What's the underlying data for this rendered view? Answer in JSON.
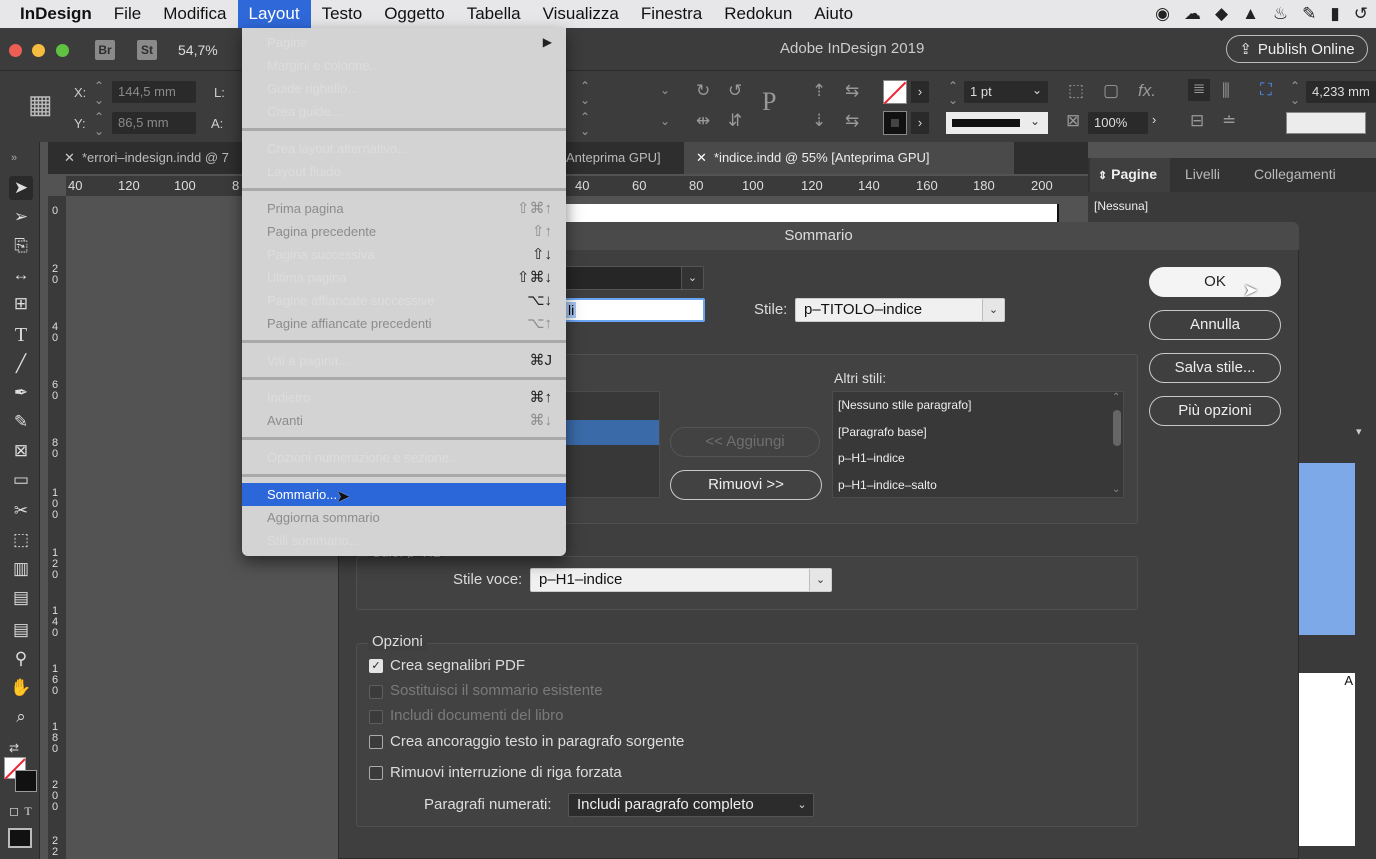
{
  "menubar": {
    "app": "InDesign",
    "items": [
      "File",
      "Modifica",
      "Layout",
      "Testo",
      "Oggetto",
      "Tabella",
      "Visualizza",
      "Finestra",
      "Redokun",
      "Aiuto"
    ]
  },
  "titlebar": {
    "br": "Br",
    "st": "St",
    "zoom": "54,7%",
    "title": "Adobe InDesign 2019",
    "publish": "Publish Online"
  },
  "controlbar": {
    "x_label": "X:",
    "x_value": "144,5 mm",
    "y_label": "Y:",
    "y_value": "86,5 mm",
    "l_label": "L:",
    "a_label": "A:",
    "stroke_weight": "1 pt",
    "opacity": "100%",
    "spacing": "4,233 mm"
  },
  "tabs": {
    "tab1": "*errori–indesign.indd @ 7",
    "tab2": "Anteprima GPU]",
    "tab3": "*indice.indd @ 55% [Anteprima GPU]"
  },
  "ruler": {
    "left": [
      "40",
      "120",
      "100",
      "8"
    ],
    "right": [
      "40",
      "60",
      "80",
      "100",
      "120",
      "140",
      "160",
      "180",
      "200"
    ],
    "vertical": [
      "0",
      "2\n0",
      "4\n0",
      "6\n0",
      "8\n0",
      "1\n0\n0",
      "1\n2\n0",
      "1\n4\n0",
      "1\n6\n0",
      "1\n8\n0",
      "2\n0\n0",
      "2\n2"
    ]
  },
  "panel": {
    "tabs": [
      "Pagine",
      "Livelli",
      "Collegamenti"
    ],
    "none": "[Nessuna]",
    "a_letter": "A"
  },
  "menu": {
    "items": [
      {
        "label": "Pagine",
        "shortcut": "▶",
        "disabled": false
      },
      {
        "label": "Margini e colonne...",
        "shortcut": "",
        "disabled": false
      },
      {
        "label": "Guide righello...",
        "shortcut": "",
        "disabled": false
      },
      {
        "label": "Crea guide...",
        "shortcut": "",
        "disabled": false
      },
      {
        "label": "Crea layout alternativo...",
        "shortcut": "",
        "disabled": false
      },
      {
        "label": "Layout fluido",
        "shortcut": "",
        "disabled": false
      },
      {
        "label": "Prima pagina",
        "shortcut": "⇧⌘↑",
        "disabled": true
      },
      {
        "label": "Pagina precedente",
        "shortcut": "⇧↑",
        "disabled": true
      },
      {
        "label": "Pagina successiva",
        "shortcut": "⇧↓",
        "disabled": false
      },
      {
        "label": "Ultima pagina",
        "shortcut": "⇧⌘↓",
        "disabled": false
      },
      {
        "label": "Pagine affiancate successive",
        "shortcut": "⌥↓",
        "disabled": false
      },
      {
        "label": "Pagine affiancate precedenti",
        "shortcut": "⌥↑",
        "disabled": true
      },
      {
        "label": "Vai a pagina...",
        "shortcut": "⌘J",
        "disabled": false
      },
      {
        "label": "Indietro",
        "shortcut": "⌘↑",
        "disabled": false
      },
      {
        "label": "Avanti",
        "shortcut": "⌘↓",
        "disabled": true
      },
      {
        "label": "Opzioni numerazione e sezione...",
        "shortcut": "",
        "disabled": false
      },
      {
        "label": "Sommario...",
        "shortcut": "",
        "disabled": false,
        "highlighted": true
      },
      {
        "label": "Aggiorna sommario",
        "shortcut": "",
        "disabled": true
      },
      {
        "label": "Stili sommario...",
        "shortcut": "",
        "disabled": false
      }
    ]
  },
  "dialog": {
    "title": "Sommario",
    "title_field_value": "li",
    "style_label": "Stile:",
    "style_value": "p–TITOLO–indice",
    "buttons": {
      "ok": "OK",
      "cancel": "Annulla",
      "save": "Salva stile...",
      "more": "Più opzioni"
    },
    "add_button": "<< Aggiungi",
    "remove_button": "Rimuovi >>",
    "other_styles_label": "Altri stili:",
    "other_styles": [
      "[Nessuno stile paragrafo]",
      "[Paragrafo base]",
      "p–H1–indice",
      "p–H1–indice–salto"
    ],
    "style_heading": "Stile: p–H1",
    "entry_style_label": "Stile voce:",
    "entry_style_value": "p–H1–indice",
    "options_label": "Opzioni",
    "options": [
      {
        "label": "Crea segnalibri PDF",
        "checked": true,
        "disabled": false
      },
      {
        "label": "Sostituisci il sommario esistente",
        "checked": false,
        "disabled": true
      },
      {
        "label": "Includi documenti del libro",
        "checked": false,
        "disabled": true
      },
      {
        "label": "Crea ancoraggio testo in paragrafo sorgente",
        "checked": false,
        "disabled": false
      },
      {
        "label": "Rimuovi interruzione di riga forzata",
        "checked": false,
        "disabled": false
      }
    ],
    "numbered_label": "Paragrafi numerati:",
    "numbered_value": "Includi paragrafo completo"
  }
}
